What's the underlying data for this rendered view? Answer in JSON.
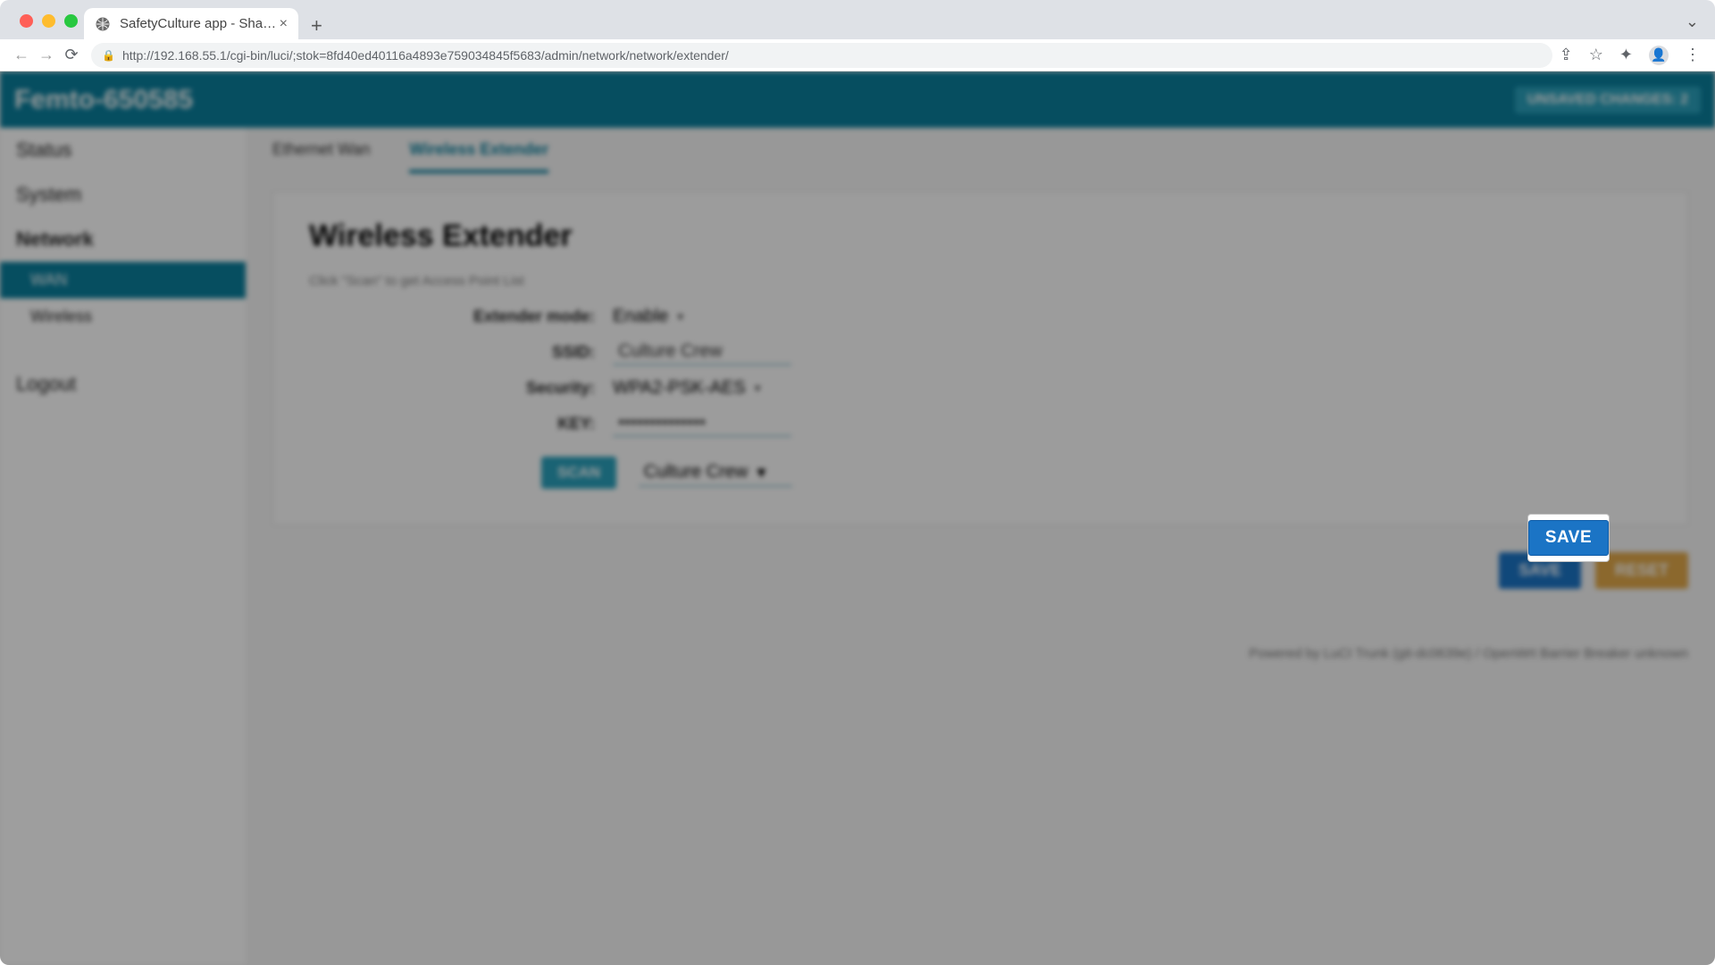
{
  "browser": {
    "tab_title": "SafetyCulture app - SharePoint",
    "url": "http://192.168.55.1/cgi-bin/luci/;stok=8fd40ed40116a4893e759034845f5683/admin/network/network/extender/"
  },
  "header": {
    "device_name": "Femto-650585",
    "unsaved_label": "UNSAVED CHANGES: 2"
  },
  "sidebar": {
    "items": [
      {
        "label": "Status"
      },
      {
        "label": "System"
      },
      {
        "label": "Network",
        "bold": true
      },
      {
        "label": "WAN"
      },
      {
        "label": "Wireless"
      },
      {
        "label": "Logout"
      }
    ]
  },
  "tabs": [
    {
      "label": "Ethernet Wan"
    },
    {
      "label": "Wireless Extender"
    }
  ],
  "panel": {
    "title": "Wireless Extender",
    "hint": "Click \"Scan\" to get Access Point List",
    "fields": {
      "extender_mode": {
        "label": "Extender mode:",
        "value": "Enable"
      },
      "ssid": {
        "label": "SSID:",
        "value": "Culture Crew"
      },
      "security": {
        "label": "Security:",
        "value": "WPA2-PSK-AES"
      },
      "key": {
        "label": "KEY:",
        "value": "••••••••••••••"
      },
      "ap": {
        "value": "Culture Crew"
      }
    },
    "scan_label": "SCAN"
  },
  "actions": {
    "save": "SAVE",
    "reset": "RESET"
  },
  "footer": "Powered by LuCI Trunk (git-dc0639e) / OpenWrt Barrier Breaker unknown"
}
